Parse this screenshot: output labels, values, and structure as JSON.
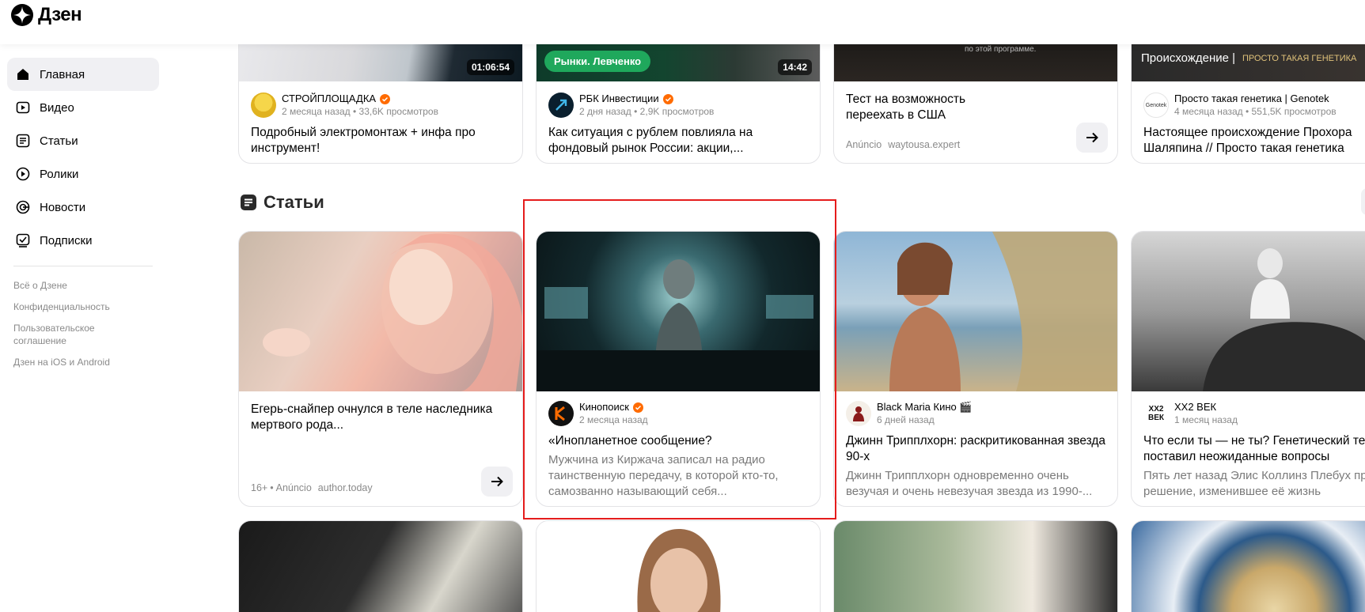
{
  "app": {
    "logo_text": "Дзен"
  },
  "sidebar": {
    "items": [
      {
        "label": "Главная",
        "icon": "home-icon",
        "active": true
      },
      {
        "label": "Видео",
        "icon": "video-icon",
        "active": false
      },
      {
        "label": "Статьи",
        "icon": "article-icon",
        "active": false
      },
      {
        "label": "Ролики",
        "icon": "shorts-icon",
        "active": false
      },
      {
        "label": "Новости",
        "icon": "news-icon",
        "active": false
      },
      {
        "label": "Подписки",
        "icon": "subscriptions-icon",
        "active": false
      }
    ],
    "links": [
      "Всё о Дзене",
      "Конфиденциальность",
      "Пользовательское соглашение",
      "Дзен на iOS и Android"
    ]
  },
  "top_row": [
    {
      "source": "СТРОЙПЛОЩАДКА",
      "verified": true,
      "meta": "2 месяца назад • 33,6K просмотров",
      "title": "Подробный электромонтаж + инфа про инструмент!",
      "duration": "01:06:54"
    },
    {
      "source": "РБК Инвестиции",
      "verified": true,
      "meta": "2 дня назад • 2,9K просмотров",
      "title": "Как ситуация с рублем повлияла на фондовый рынок России: акции,...",
      "duration": "14:42",
      "pill": "Рынки. Левченко"
    },
    {
      "title": "Тест на возможность переехать в США",
      "ad_label": "Anúncio",
      "ad_domain": "waytousa.expert",
      "thumb_caption": "по этой программе."
    },
    {
      "source": "Просто такая генетика | Genotek",
      "meta": "4 месяца назад • 551,5K просмотров",
      "title": "Настоящее происхождение Прохора Шаляпина // Просто такая генетика",
      "thumb_caption_a": "Происхождение |",
      "thumb_caption_b": "ПРОСТО ТАКАЯ ГЕНЕТИКА",
      "avatar_text": "Genotek"
    }
  ],
  "section": {
    "title": "Статьи"
  },
  "articles": [
    {
      "title": "Егерь-снайпер очнулся в теле наследника мертвого рода...",
      "age": "16+",
      "ad_label": "Anúncio",
      "ad_domain": "author.today"
    },
    {
      "source": "Кинопоиск",
      "verified": true,
      "meta": "2 месяца назад",
      "title": "«Инопланетное сообщение?",
      "desc": "Мужчина из Киржача записал на радио таинственную передачу, в которой кто-то, самозванно называющий себя..."
    },
    {
      "source": "Black Maria Кино 🎬",
      "meta": "6 дней назад",
      "title": "Джинн Трипплхорн: раскритикованная звезда 90-х",
      "desc": "Джинн Трипплхорн одновременно очень везучая и очень невезучая звезда из 1990-..."
    },
    {
      "source": "ХХ2 ВЕК",
      "meta": "1 месяц назад",
      "title": "Что если ты — не ты? Генетический тест поставил неожиданные вопросы",
      "desc": "Пять лет назад Элис Коллинз Плебух приняла решение, изменившее её жизнь",
      "avatar_text_a": "XX2",
      "avatar_text_b": "ВЕК"
    }
  ],
  "colors": {
    "accent_verified": "#ff6b00",
    "highlight_border": "#e51c1c",
    "pill_green": "#1fa85c"
  }
}
